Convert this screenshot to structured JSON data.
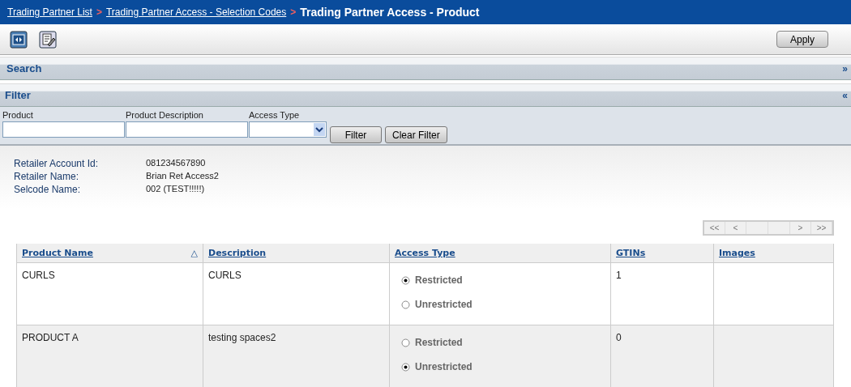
{
  "breadcrumb": {
    "links": [
      "Trading Partner List",
      "Trading Partner Access - Selection Codes"
    ],
    "separator": ">",
    "title": "Trading Partner Access - Product"
  },
  "toolbar": {
    "apply": "Apply"
  },
  "panels": [
    {
      "title": "Search",
      "toggle": "»",
      "expanded": false
    },
    {
      "title": "Filter",
      "toggle": "«",
      "expanded": true
    }
  ],
  "filter": {
    "fields": [
      {
        "label": "Product",
        "kind": "text"
      },
      {
        "label": "Product Description",
        "kind": "text"
      },
      {
        "label": "Access Type",
        "kind": "select"
      }
    ],
    "buttons": [
      "Filter",
      "Clear Filter"
    ]
  },
  "info": [
    {
      "label": "Retailer Account Id:",
      "value": "081234567890"
    },
    {
      "label": "Retailer Name:",
      "value": "Brian Ret Access2"
    },
    {
      "label": "Selcode Name:",
      "value": "002 (TEST!!!!!)"
    }
  ],
  "pager": {
    "first": "<<",
    "prev": "<",
    "next": ">",
    "last": ">>",
    "disabled": true
  },
  "table": {
    "columns": [
      {
        "label": "Product Name",
        "sort": "△"
      },
      {
        "label": "Description"
      },
      {
        "label": "Access Type"
      },
      {
        "label": "GTINs"
      },
      {
        "label": "Images"
      }
    ],
    "rows": [
      {
        "product": "CURLS",
        "description": "CURLS",
        "options": [
          {
            "label": "Restricted",
            "selected": true
          },
          {
            "label": "Unrestricted",
            "selected": false
          }
        ],
        "gtins": "1"
      },
      {
        "product": "PRODUCT A",
        "description": "testing spaces2",
        "options": [
          {
            "label": "Restricted",
            "selected": false
          },
          {
            "label": "Unrestricted",
            "selected": true
          }
        ],
        "gtins": "0"
      }
    ]
  }
}
